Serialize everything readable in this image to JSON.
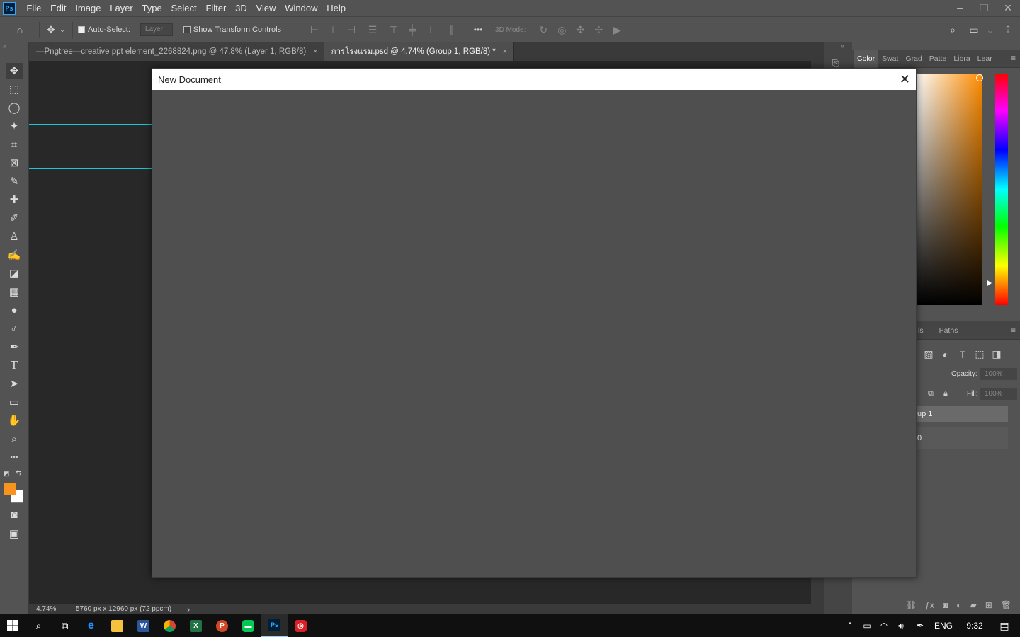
{
  "app": {
    "logo": "Ps"
  },
  "menu": [
    "File",
    "Edit",
    "Image",
    "Layer",
    "Type",
    "Select",
    "Filter",
    "3D",
    "View",
    "Window",
    "Help"
  ],
  "window_controls": {
    "minimize": "–",
    "restore": "❐",
    "close": "✕"
  },
  "options_bar": {
    "auto_select_label": "Auto-Select:",
    "layer_value": "Layer",
    "show_transform_label": "Show Transform Controls",
    "mode_3d_label": "3D Mode:",
    "more": "•••"
  },
  "tabs": [
    {
      "label": "—Pngtree—creative ppt element_2268824.png @ 47.8% (Layer 1, RGB/8)",
      "close": "×"
    },
    {
      "label": "การโรงแรม.psd @ 4.74% (Group 1, RGB/8) *",
      "close": "×"
    }
  ],
  "status": {
    "zoom": "4.74%",
    "doc_info": "5760 px x 12960 px (72 ppcm)",
    "arrow": "›"
  },
  "right_panel": {
    "color_tabs": [
      "Color",
      "Swat",
      "Grad",
      "Patte",
      "Libra",
      "Lear"
    ],
    "layers_tabs": [
      "ls",
      "Paths"
    ],
    "opacity_label": "Opacity:",
    "opacity_value": "100%",
    "fill_label": "Fill:",
    "fill_value": "100%",
    "layer_group_name": "up 1",
    "layer_row2": "0"
  },
  "colors": {
    "foreground": "#f7931e",
    "background": "#ffffff",
    "guide": "#19c7d8"
  },
  "dialog": {
    "title": "New Document",
    "close": "✕"
  },
  "taskbar": {
    "language": "ENG",
    "time": "9:32"
  }
}
